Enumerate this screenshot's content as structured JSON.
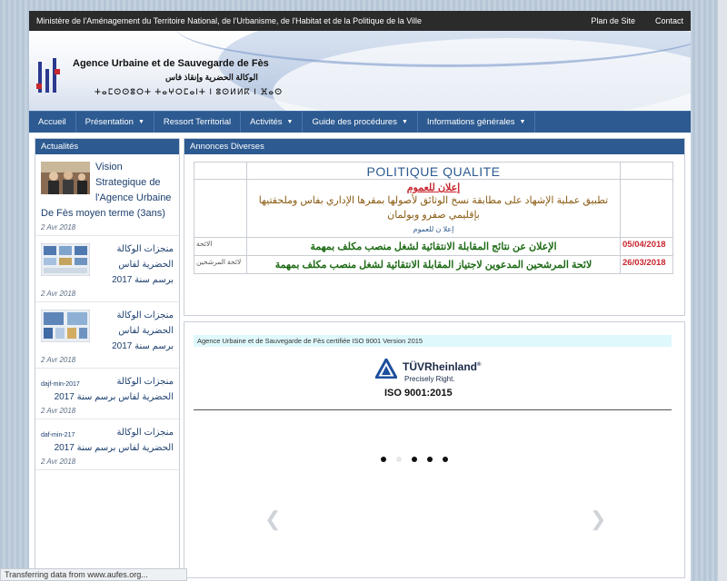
{
  "topbar": {
    "ministry": "Ministère de l'Aménagement du Territoire National, de l'Urbanisme, de l'Habitat et de la Politique de la Ville",
    "links": [
      "Plan de Site",
      "Contact"
    ]
  },
  "brand": {
    "name_fr": "Agence Urbaine et de Sauvegarde de Fès",
    "name_ar": "الوكالة الحضرية وإنقاذ فاس",
    "name_tifinagh": "ⵜⴰⵎⵙⵙⵓⵔⵜ ⵜⴰⵖⵔⵎⴰⵏⵜ ⵏ ⵓⵙⵍⵍⴽ ⵏ ⴼⴰⵙ"
  },
  "nav": [
    {
      "label": "Accueil",
      "dropdown": false
    },
    {
      "label": "Présentation",
      "dropdown": true
    },
    {
      "label": "Ressort Territorial",
      "dropdown": false
    },
    {
      "label": "Activités",
      "dropdown": true
    },
    {
      "label": "Guide des procédures",
      "dropdown": true
    },
    {
      "label": "Informations générales",
      "dropdown": true
    }
  ],
  "sidebar": {
    "title": "Actualités",
    "items": [
      {
        "title": "Vision Strategique de l'Agence Urbaine De Fès moyen terme (3ans)",
        "date": "2 Avr 2018",
        "tag": ""
      },
      {
        "title": "منجزات الوكالة الحضرية لفاس برسم سنة 2017",
        "date": "2 Avr 2018",
        "tag": ""
      },
      {
        "title": "منجزات الوكالة الحضرية لفاس برسم سنة 2017",
        "date": "2 Avr 2018",
        "tag": ""
      },
      {
        "title": "منجزات الوكالة الحضرية لفاس برسم سنة 2017",
        "date": "2 Avr 2018",
        "tag": "dajf-min-2017"
      },
      {
        "title": "منجزات الوكالة الحضرية لفاس برسم سنة 2017",
        "date": "2 Avr 2018",
        "tag": "daf-min-217"
      }
    ]
  },
  "annonces": {
    "title": "Annonces Diverses",
    "quality_title": "POLITIQUE QUALITE",
    "notice_head": "إعلان للعموم",
    "notice_body": "تطبيق عملية الإشهاد على مطابقة نسخ الوثائق لأصولها بمقرها الإداري بفاس وملحقتيها بإقليمي صفرو وبولمان",
    "notice_link": "إعلا ن للعموم",
    "rows": [
      {
        "left": "الائحة",
        "text": "الإعلان عن نتائج المقابلة الانتقائية لشغل منصب مكلف بمهمة",
        "date": "05/04/2018"
      },
      {
        "left": "لائحة المرشحين",
        "text": "لائحة المرشحين المدعوين لاجتياز المقابلة الانتقائية لشغل منصب مكلف بمهمة",
        "date": "26/03/2018"
      }
    ]
  },
  "cert": {
    "caption": "Agence Urbaine et de Sauvegarde de Fès  certifiée ISO 9001 Version 2015",
    "brand": "TÜVRheinland",
    "tagline": "Precisely Right.",
    "standard": "ISO 9001:2015",
    "slide_dots": 5,
    "active_dot": 2
  },
  "status": "Transferring data from www.aufes.org...",
  "colors": {
    "nav": "#2c5a91",
    "topbar": "#2b2b2b",
    "alert_red": "#c8262e",
    "green": "#1c6a14"
  }
}
